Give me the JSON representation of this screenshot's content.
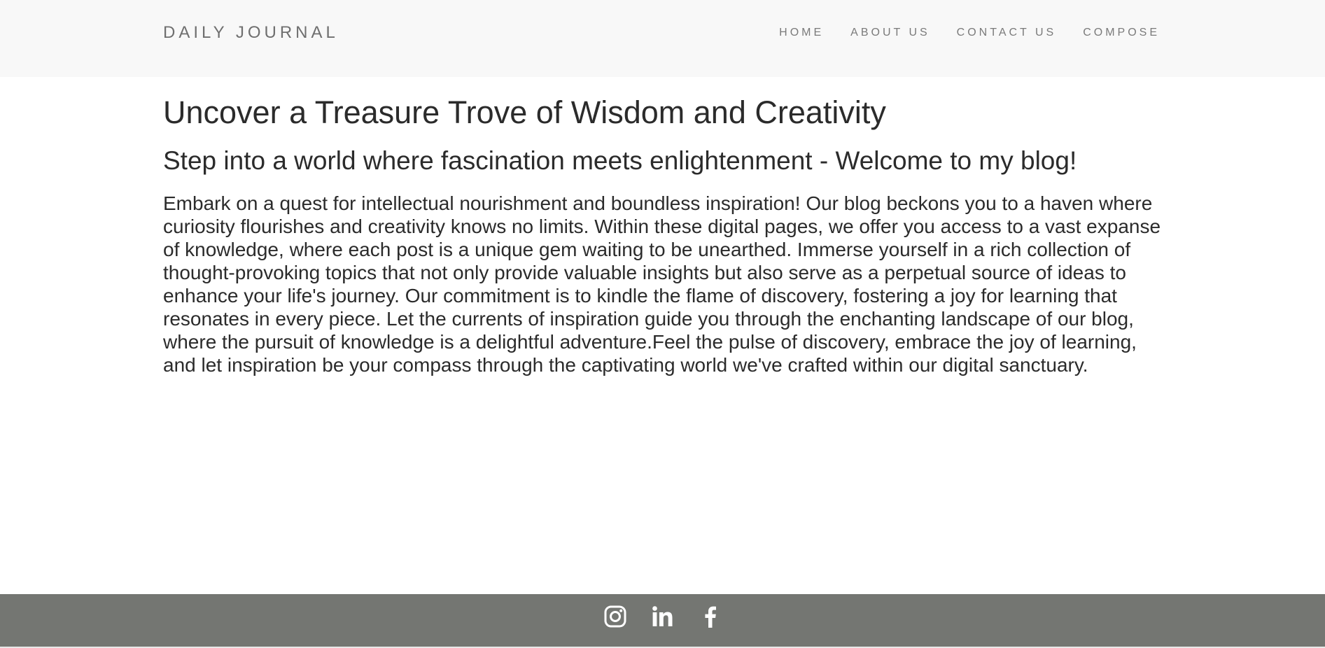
{
  "navbar": {
    "brand": "DAILY JOURNAL",
    "items": [
      {
        "label": "HOME"
      },
      {
        "label": "ABOUT US"
      },
      {
        "label": "CONTACT US"
      },
      {
        "label": "COMPOSE"
      }
    ]
  },
  "main": {
    "title": "Uncover a Treasure Trove of Wisdom and Creativity",
    "subtitle": "Step into a world where fascination meets enlightenment - Welcome to my blog!",
    "body": "Embark on a quest for intellectual nourishment and boundless inspiration! Our blog beckons you to a haven where curiosity flourishes and creativity knows no limits. Within these digital pages, we offer you access to a vast expanse of knowledge, where each post is a unique gem waiting to be unearthed. Immerse yourself in a rich collection of thought-provoking topics that not only provide valuable insights but also serve as a perpetual source of ideas to enhance your life's journey. Our commitment is to kindle the flame of discovery, fostering a joy for learning that resonates in every piece. Let the currents of inspiration guide you through the enchanting landscape of our blog, where the pursuit of knowledge is a delightful adventure.Feel the pulse of discovery, embrace the joy of learning, and let inspiration be your compass through the captivating world we've crafted within our digital sanctuary."
  },
  "footer": {
    "icons": [
      "instagram-icon",
      "linkedin-icon",
      "facebook-icon"
    ]
  },
  "colors": {
    "navbar_bg": "#f8f8f8",
    "footer_bg": "#747672",
    "text": "#2b2b2b"
  }
}
